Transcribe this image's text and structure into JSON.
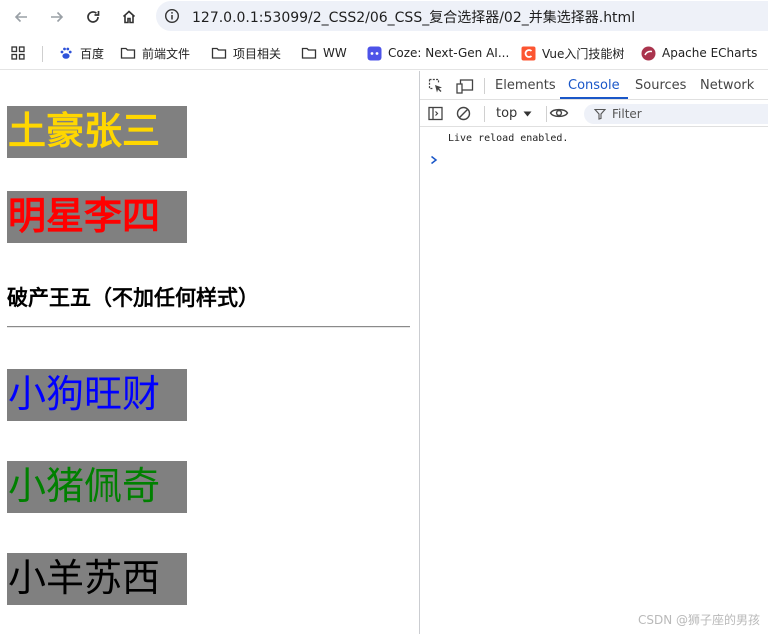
{
  "browser": {
    "url": "127.0.0.1:53099/2_CSS2/06_CSS_复合选择器/02_并集选择器.html"
  },
  "bookmarks": [
    {
      "label": "百度",
      "icon": "baidu-paw-icon"
    },
    {
      "label": "前端文件",
      "icon": "folder-icon"
    },
    {
      "label": "项目相关",
      "icon": "folder-icon"
    },
    {
      "label": "WW",
      "icon": "folder-icon"
    },
    {
      "label": "Coze: Next-Gen AI...",
      "icon": "coze-icon"
    },
    {
      "label": "Vue入门技能树",
      "icon": "csdn-icon"
    },
    {
      "label": "Apache ECharts",
      "icon": "echarts-icon"
    }
  ],
  "page": {
    "items": [
      {
        "text": "土豪张三",
        "color": "#ffd700"
      },
      {
        "text": "明星李四",
        "color": "#ff0000"
      },
      {
        "text": "小狗旺财",
        "color": "#0000ff"
      },
      {
        "text": "小猪佩奇",
        "color": "#008000"
      },
      {
        "text": "小羊苏西",
        "color": "#000000"
      }
    ],
    "box_bg": "#808080",
    "plain_heading": "破产王五（不加任何样式）"
  },
  "devtools": {
    "tabs": [
      "Elements",
      "Console",
      "Sources",
      "Network"
    ],
    "active_tab": "Console",
    "context": "top",
    "filter_placeholder": "Filter",
    "log": "Live reload enabled.",
    "accent": "#1a57c8"
  },
  "watermark": "CSDN @狮子座的男孩"
}
